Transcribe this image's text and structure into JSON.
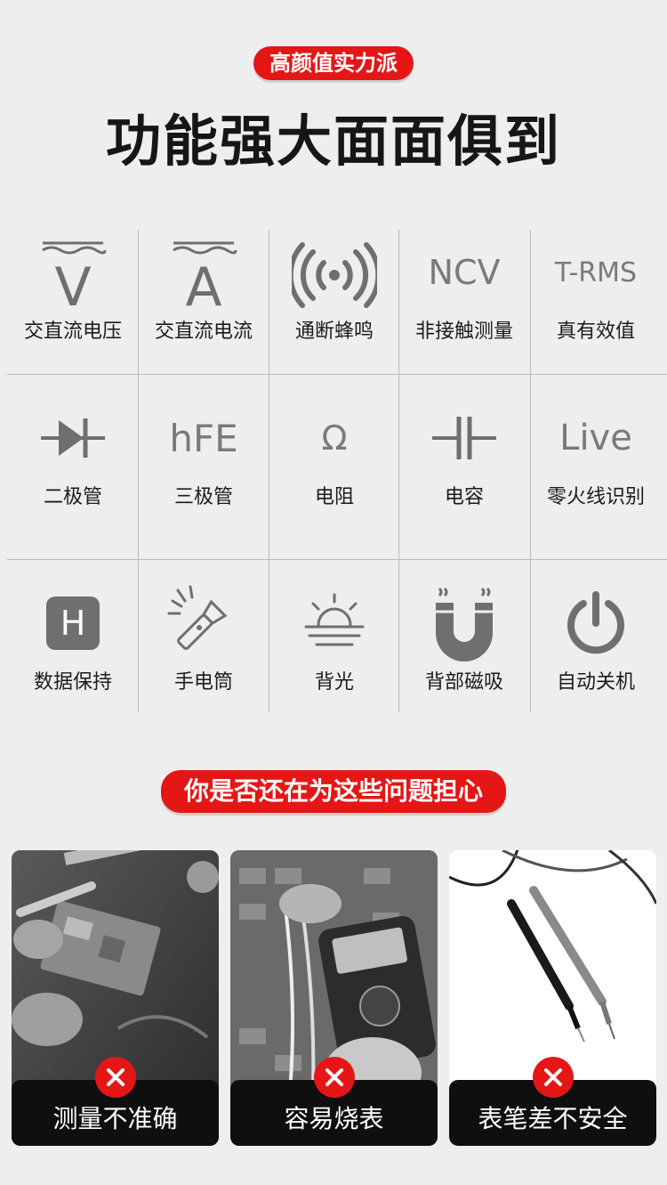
{
  "header": {
    "badge": "高颜值实力派",
    "headline": "功能强大面面俱到"
  },
  "features": [
    {
      "icon": "ac-voltage-icon",
      "glyph": "V",
      "label": "交直流电压"
    },
    {
      "icon": "ac-current-icon",
      "glyph": "A",
      "label": "交直流电流"
    },
    {
      "icon": "continuity-buzzer-icon",
      "glyph": "",
      "label": "通断蜂鸣"
    },
    {
      "icon": "ncv-icon",
      "glyph": "NCV",
      "label": "非接触测量"
    },
    {
      "icon": "trms-icon",
      "glyph": "T-RMS",
      "label": "真有效值"
    },
    {
      "icon": "diode-icon",
      "glyph": "",
      "label": "二极管"
    },
    {
      "icon": "hfe-icon",
      "glyph": "hFE",
      "label": "三极管"
    },
    {
      "icon": "ohm-icon",
      "glyph": "Ω",
      "label": "电阻"
    },
    {
      "icon": "capacitor-icon",
      "glyph": "",
      "label": "电容"
    },
    {
      "icon": "live-icon",
      "glyph": "Live",
      "label": "零火线识别"
    },
    {
      "icon": "hold-icon",
      "glyph": "H",
      "label": "数据保持"
    },
    {
      "icon": "flashlight-icon",
      "glyph": "",
      "label": "手电筒"
    },
    {
      "icon": "backlight-icon",
      "glyph": "",
      "label": "背光"
    },
    {
      "icon": "magnet-icon",
      "glyph": "",
      "label": "背部磁吸"
    },
    {
      "icon": "power-icon",
      "glyph": "",
      "label": "自动关机"
    }
  ],
  "problems": {
    "badge": "你是否还在为这些问题担心",
    "cards": [
      {
        "caption": "测量不准确",
        "image": "circuit-board-repair-photo"
      },
      {
        "caption": "容易烧表",
        "image": "multimeter-in-hand-photo"
      },
      {
        "caption": "表笔差不安全",
        "image": "test-leads-photo"
      }
    ]
  },
  "colors": {
    "accent": "#e51616",
    "background": "#eeeeee",
    "icon": "#6f6f6f"
  }
}
